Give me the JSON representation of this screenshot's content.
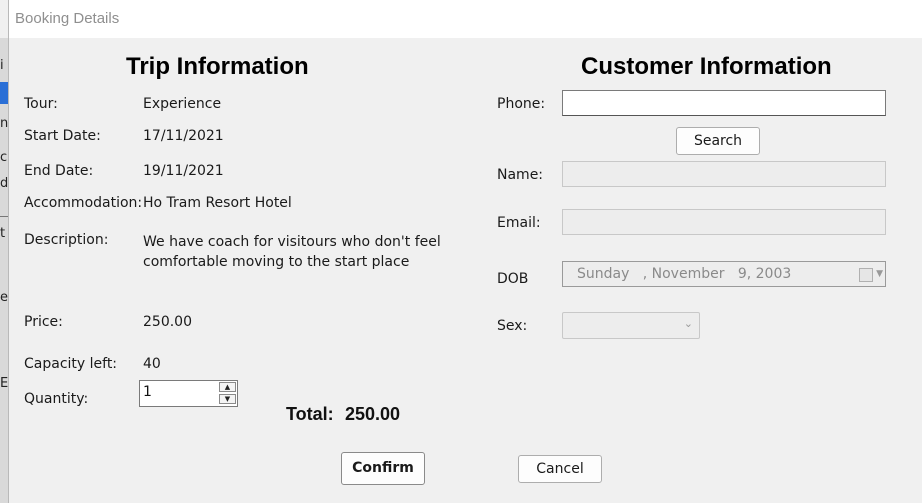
{
  "window": {
    "title": "Booking Details"
  },
  "trip": {
    "heading": "Trip Information",
    "tour_label": "Tour:",
    "tour_value": "Experience",
    "start_label": "Start Date:",
    "start_value": "17/11/2021",
    "end_label": "End Date:",
    "end_value": "19/11/2021",
    "accom_label": "Accommodation:",
    "accom_value": "Ho Tram Resort Hotel",
    "desc_label": "Description:",
    "desc_line1": "We have coach for visitours who don't feel",
    "desc_line2": "comfortable moving to the start place",
    "price_label": "Price:",
    "price_value": "250.00",
    "capacity_label": "Capacity left:",
    "capacity_value": "40",
    "quantity_label": "Quantity:",
    "quantity_value": "1"
  },
  "customer": {
    "heading": "Customer Information",
    "phone_label": "Phone:",
    "phone_value": "",
    "search_label": "Search",
    "name_label": "Name:",
    "name_value": "",
    "email_label": "Email:",
    "email_value": "",
    "dob_label": "DOB",
    "dob_value": "Sunday   , November   9, 2003",
    "sex_label": "Sex:",
    "sex_value": ""
  },
  "total": {
    "label": "Total:",
    "value": "250.00"
  },
  "actions": {
    "confirm_label": "Confirm",
    "cancel_label": "Cancel"
  },
  "background_fragments": [
    "i",
    "n",
    "c",
    "d",
    "t",
    "e",
    "E"
  ],
  "icons": {
    "calendar": "calendar-icon",
    "chevron": "chevron-down-icon",
    "spin_up": "spin-up-icon",
    "spin_down": "spin-down-icon"
  }
}
